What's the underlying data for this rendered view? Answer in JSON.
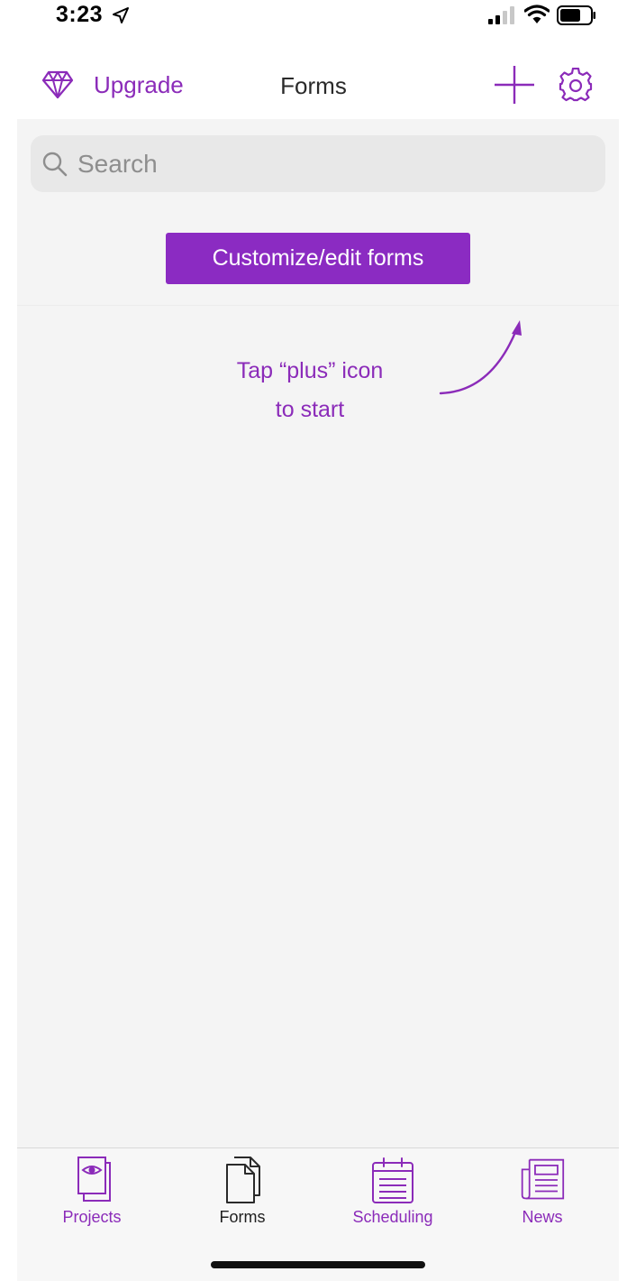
{
  "status_bar": {
    "time": "3:23",
    "icons": [
      "location-arrow-icon",
      "signal-bars-icon",
      "wifi-icon",
      "battery-icon"
    ]
  },
  "nav": {
    "upgrade_label": "Upgrade",
    "title": "Forms",
    "icons": [
      "diamond-icon",
      "plus-icon",
      "gear-icon"
    ]
  },
  "search": {
    "placeholder": "Search",
    "value": ""
  },
  "customize_button": {
    "label": "Customize/edit forms"
  },
  "hint": {
    "line1": "Tap “plus” icon",
    "line2": "to start"
  },
  "tabs": [
    {
      "label": "Projects",
      "icon": "projects-icon",
      "active": false
    },
    {
      "label": "Forms",
      "icon": "forms-icon",
      "active": true
    },
    {
      "label": "Scheduling",
      "icon": "scheduling-icon",
      "active": false
    },
    {
      "label": "News",
      "icon": "news-icon",
      "active": false
    }
  ],
  "colors": {
    "accent": "#8b2bb9",
    "button": "#8b2bc2",
    "content_bg": "#f4f4f4",
    "search_bg": "#e8e8e8",
    "text_dark": "#2a2a2a"
  }
}
